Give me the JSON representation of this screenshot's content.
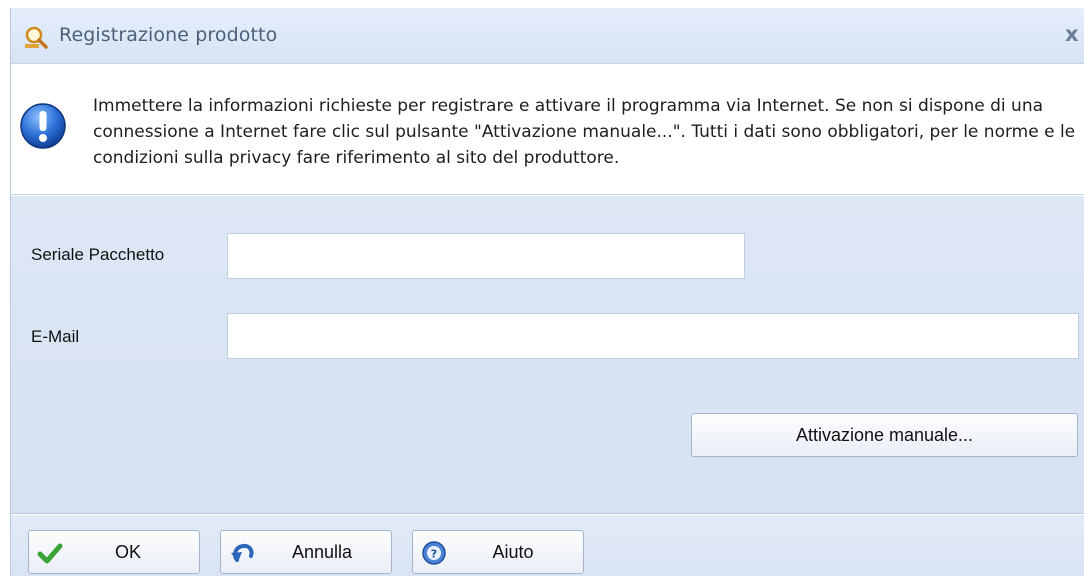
{
  "window": {
    "title": "Registrazione prodotto",
    "close_label": "x"
  },
  "info": {
    "icon": "exclamation-info-icon",
    "message": "Immettere la informazioni richieste per registrare e attivare il programma via Internet. Se non si dispone di una connessione a Internet fare clic sul pulsante \"Attivazione manuale...\". Tutti i dati sono obbligatori, per le norme e le condizioni sulla privacy fare riferimento al sito del produttore."
  },
  "form": {
    "serial_label": "Seriale Pacchetto",
    "serial_value": "",
    "email_label": "E-Mail",
    "email_value": "",
    "manual_button": "Attivazione manuale..."
  },
  "footer": {
    "ok_label": "OK",
    "cancel_label": "Annulla",
    "help_label": "Aiuto"
  },
  "colors": {
    "titlebar": "#dde7f4",
    "form_background": "#d9e4f3",
    "info_icon": "#1e62c9",
    "ok_check": "#3aa335"
  }
}
